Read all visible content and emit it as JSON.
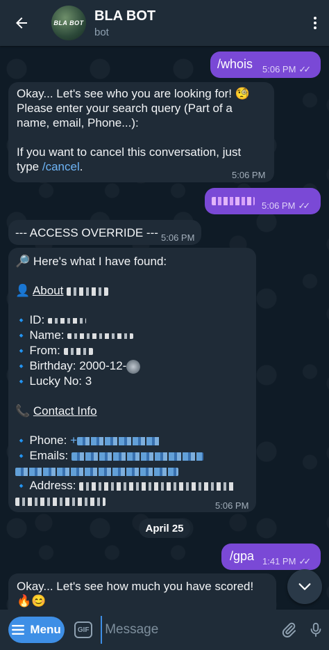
{
  "header": {
    "title": "BLA BOT",
    "subtitle": "bot",
    "avatar_text": "BLA BOT"
  },
  "messages": {
    "whois": {
      "text": "/whois",
      "time": "5:06 PM"
    },
    "prompt": {
      "line1": "Okay... Let's see who you are looking for! 🧐",
      "line2": "Please enter your search query (Part of a",
      "line3": "name, email, Phone...):",
      "line4": "If you want to cancel this conversation, just",
      "line5_prefix": "type ",
      "line5_link": "/cancel",
      "line5_suffix": ".",
      "time": "5:06 PM"
    },
    "query": {
      "time": "5:06 PM"
    },
    "override": {
      "text": "--- ACCESS OVERRIDE ---",
      "time": "5:06 PM"
    },
    "result": {
      "found": "🔎 Here's what I have found:",
      "about_icon": "👤",
      "about_label": "About",
      "id_label": "ID:",
      "name_label": "Name:",
      "from_label": "From:",
      "birthday_label": "Birthday:",
      "birthday_value": "2000-12-",
      "lucky_label": "Lucky No:",
      "lucky_value": "3",
      "contact_icon": "📞",
      "contact_label": "Contact Info",
      "phone_label": "Phone:",
      "phone_value": "+",
      "emails_label": "Emails:",
      "address_label": "Address:",
      "time": "5:06 PM"
    },
    "date_divider": "April 25",
    "gpa": {
      "text": "/gpa",
      "time": "1:41 PM"
    },
    "score": {
      "line1": "Okay... Let's see how much you have scored!",
      "line2": "🔥😊"
    }
  },
  "input_bar": {
    "menu_label": "Menu",
    "gif_label": "GIF",
    "placeholder": "Message"
  },
  "icons": {
    "back": "arrow-left",
    "more": "vertical-dots",
    "scroll": "chevron-down",
    "attach": "paperclip",
    "mic": "microphone",
    "diamond": "🔹"
  },
  "colors": {
    "outgoing_bubble": "#7a49d6",
    "incoming_bubble": "#1f2b37",
    "header": "#1f2c38",
    "link": "#6eb4f5",
    "menu_button": "#3e8fe6"
  }
}
